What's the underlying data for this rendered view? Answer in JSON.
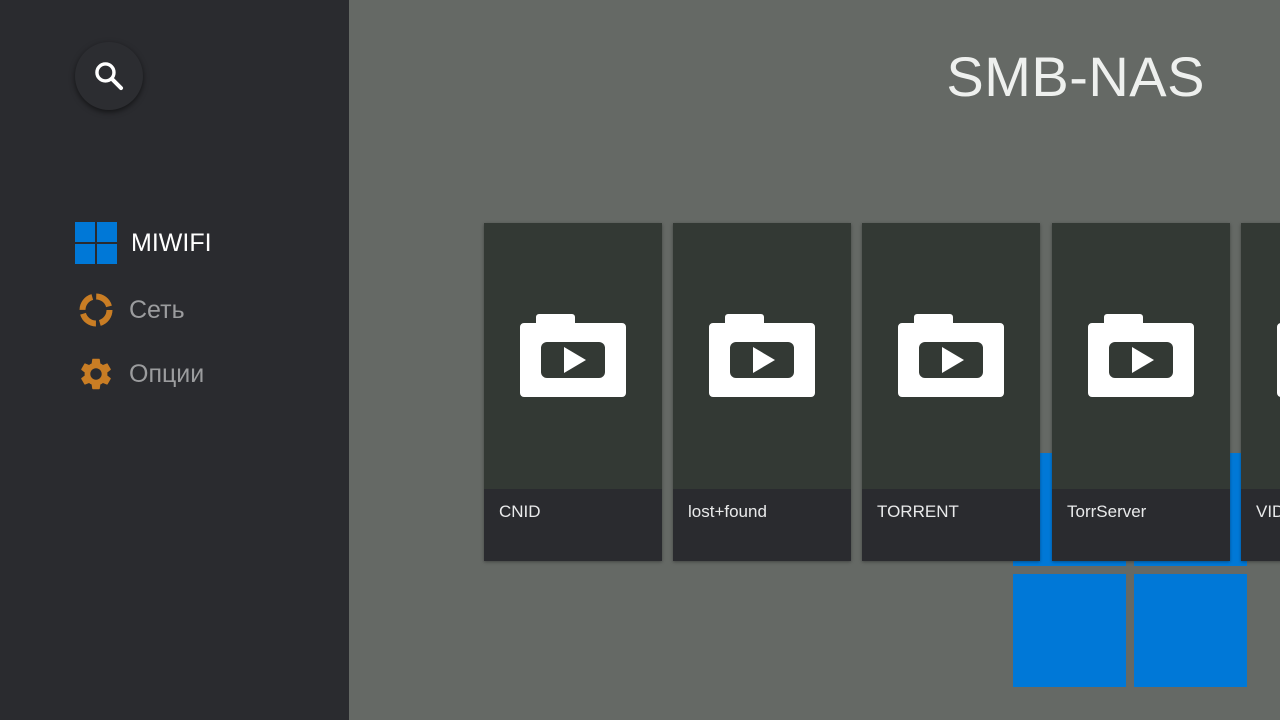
{
  "header": {
    "title": "SMB-NAS"
  },
  "search": {
    "icon": "search-icon"
  },
  "sidebar": {
    "items": [
      {
        "label": "MIWIFI",
        "icon": "windows-logo-icon",
        "active": true
      },
      {
        "label": "Сеть",
        "icon": "network-ring-icon",
        "active": false
      },
      {
        "label": "Опции",
        "icon": "gear-icon",
        "active": false
      }
    ]
  },
  "folders": [
    {
      "label": "CNID",
      "icon": "video-folder-icon"
    },
    {
      "label": "lost+found",
      "icon": "video-folder-icon"
    },
    {
      "label": "TORRENT",
      "icon": "video-folder-icon"
    },
    {
      "label": "TorrServer",
      "icon": "video-folder-icon"
    },
    {
      "label": "VID",
      "icon": "video-folder-icon"
    }
  ],
  "colors": {
    "accent": "#0078d7",
    "icon_orange": "#c97d24",
    "sidebar_bg": "#2a2b2f",
    "main_bg": "#656965",
    "card_bg": "#333934"
  }
}
